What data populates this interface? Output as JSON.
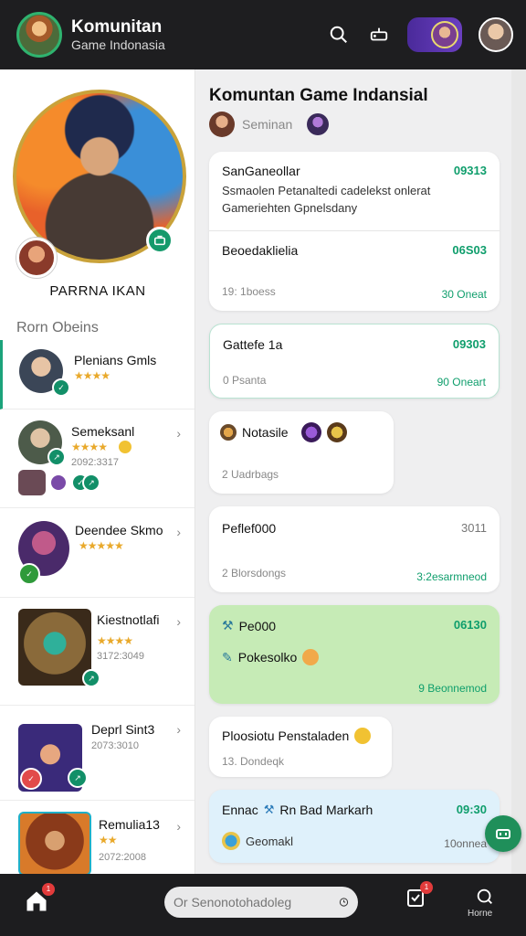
{
  "header": {
    "title": "Komunitan",
    "subtitle": "Game Indonasia"
  },
  "profile": {
    "name": "PARRNA IKAN"
  },
  "games_section": {
    "heading": "Rorn Obeins",
    "items": [
      {
        "name": "Plenians Gmls",
        "stars": "★★★★",
        "date": ""
      },
      {
        "name": "Semeksanl",
        "stars": "★★★★",
        "date": "2092:3317"
      },
      {
        "name": "Deendee Skmo",
        "stars": "★★★★★",
        "date": ""
      },
      {
        "name": "Kiestnotlafi",
        "stars": "★★★★",
        "date": "3172:3049"
      },
      {
        "name": "Deprl Sint3",
        "stars": "",
        "date": "2073:3010"
      },
      {
        "name": "Remulia13",
        "stars": "★★",
        "date": "2072:2008"
      }
    ]
  },
  "feed": {
    "title": "Komuntan Game Indansial",
    "subtitle": "Seminan",
    "card1": {
      "title": "SanGaneollar",
      "num": "09313",
      "line1": "Ssmaolen Petanaltedi cadelekst onlerat",
      "line2": "Gameriehten Gpnelsdany",
      "sub_title": "Beoedaklielia",
      "sub_num": "06S03",
      "meta": "19: 1boess",
      "tag": "30 Oneat"
    },
    "card2": {
      "title": "Gattefe 1a",
      "num": "09303",
      "meta": "0 Psanta",
      "tag": "90 Oneart"
    },
    "card3": {
      "title": "Notasile",
      "meta": "2 Uadrbags"
    },
    "card4": {
      "title": "Peflef000",
      "num": "3011",
      "meta": "2 Blorsdongs",
      "tag": "3:2esarmneod"
    },
    "card5": {
      "title": "Pe000",
      "num": "06130",
      "text": "Pokesolko",
      "tag": "9 Beonnemod"
    },
    "card6": {
      "title": "Ploosiotu Penstaladen",
      "meta": "13. Dondeqk"
    },
    "card7": {
      "title": "Ennac",
      "title2": "Rn Bad Markarh",
      "num": "09:30",
      "text": "Geomakl",
      "tag": "10onnea"
    }
  },
  "bottom_bar": {
    "search_placeholder": "Or Senonotohadoleg",
    "home_badge": "1",
    "notes_badge": "1",
    "profile_label": "Horne"
  },
  "colors": {
    "accent": "#0f9e6c",
    "header_bg": "#1e1e20",
    "star": "#e9a92b"
  }
}
